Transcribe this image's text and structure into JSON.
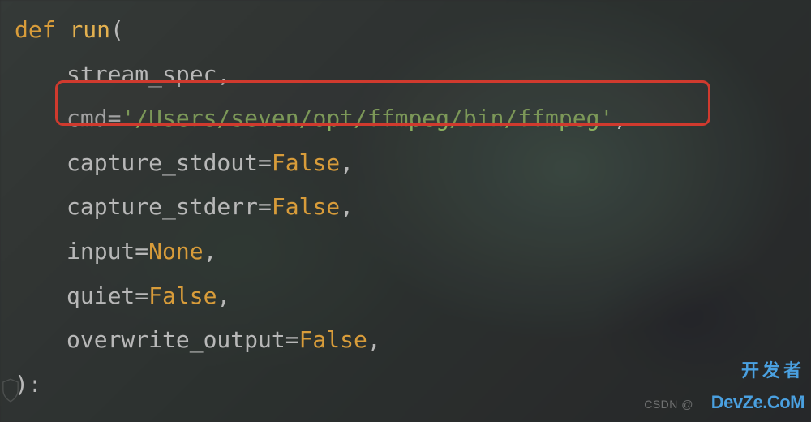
{
  "code": {
    "def_kw": "def",
    "fn_name": "run",
    "open_paren": "(",
    "lines": [
      {
        "param": "stream_spec",
        "suffix": ","
      },
      {
        "param": "cmd",
        "eq": "=",
        "value_str": "'/Users/seven/opt/ffmpeg/bin/ffmpeg'",
        "suffix": ",",
        "highlighted": true
      },
      {
        "param": "capture_stdout",
        "eq": "=",
        "value_kw": "False",
        "suffix": ","
      },
      {
        "param": "capture_stderr",
        "eq": "=",
        "value_kw": "False",
        "suffix": ","
      },
      {
        "param": "input",
        "eq": "=",
        "value_kw": "None",
        "suffix": ","
      },
      {
        "param": "quiet",
        "eq": "=",
        "value_kw": "False",
        "suffix": ","
      },
      {
        "param": "overwrite_output",
        "eq": "=",
        "value_kw": "False",
        "suffix": ","
      }
    ],
    "close_line": "):"
  },
  "watermark": {
    "csdn_prefix": "CSDN @",
    "devze_cn": "开发者",
    "devze_en": "DevZe.CoM"
  },
  "highlight_color": "#d03a2e"
}
